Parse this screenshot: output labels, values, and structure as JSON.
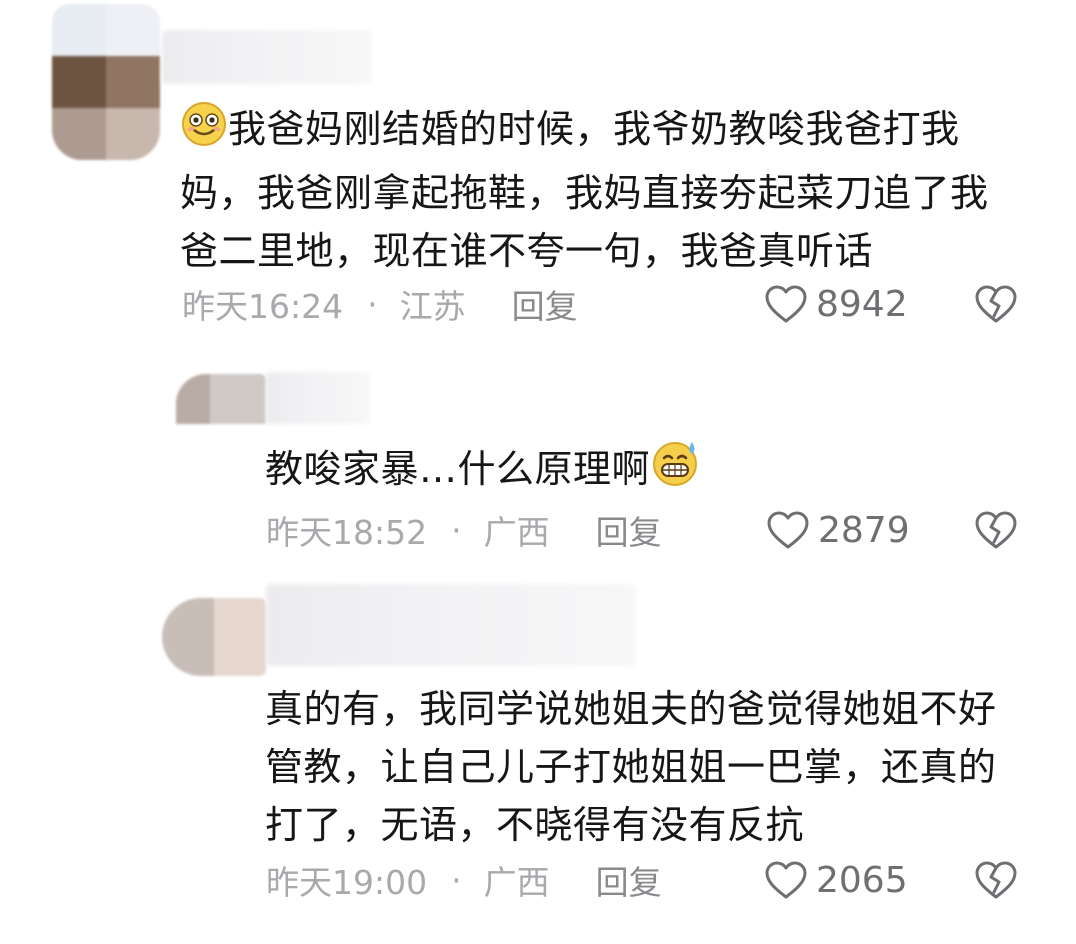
{
  "comments": [
    {
      "text_lines": [
        "我爸妈刚结婚的时候，我爷奶教唆我爸打我",
        "妈，我爸刚拿起拖鞋，我妈直接夯起菜刀追了我",
        "爸二里地，现在谁不夸一句，我爸真听话"
      ],
      "leading_emoji": "smiling-face-icon",
      "time": "昨天16:24",
      "separator": "·",
      "location": "江苏",
      "reply_label": "回复",
      "like_count": "8942"
    },
    {
      "text_lines": [
        "教唆家暴…什么原理啊"
      ],
      "trailing_emoji": "grinning-sweat-icon",
      "time": "昨天18:52",
      "separator": "·",
      "location": "广西",
      "reply_label": "回复",
      "like_count": "2879"
    },
    {
      "text_lines": [
        "真的有，我同学说她姐夫的爸觉得她姐不好",
        "管教，让自己儿子打她姐姐一巴掌，还真的",
        "打了，无语，不晓得有没有反抗"
      ],
      "time": "昨天19:00",
      "separator": "·",
      "location": "广西",
      "reply_label": "回复",
      "like_count": "2065"
    }
  ],
  "colors": {
    "text": "#161616",
    "meta": "#a9a9ad",
    "reply": "#8a8a8e",
    "icon": "#6f6f73"
  }
}
